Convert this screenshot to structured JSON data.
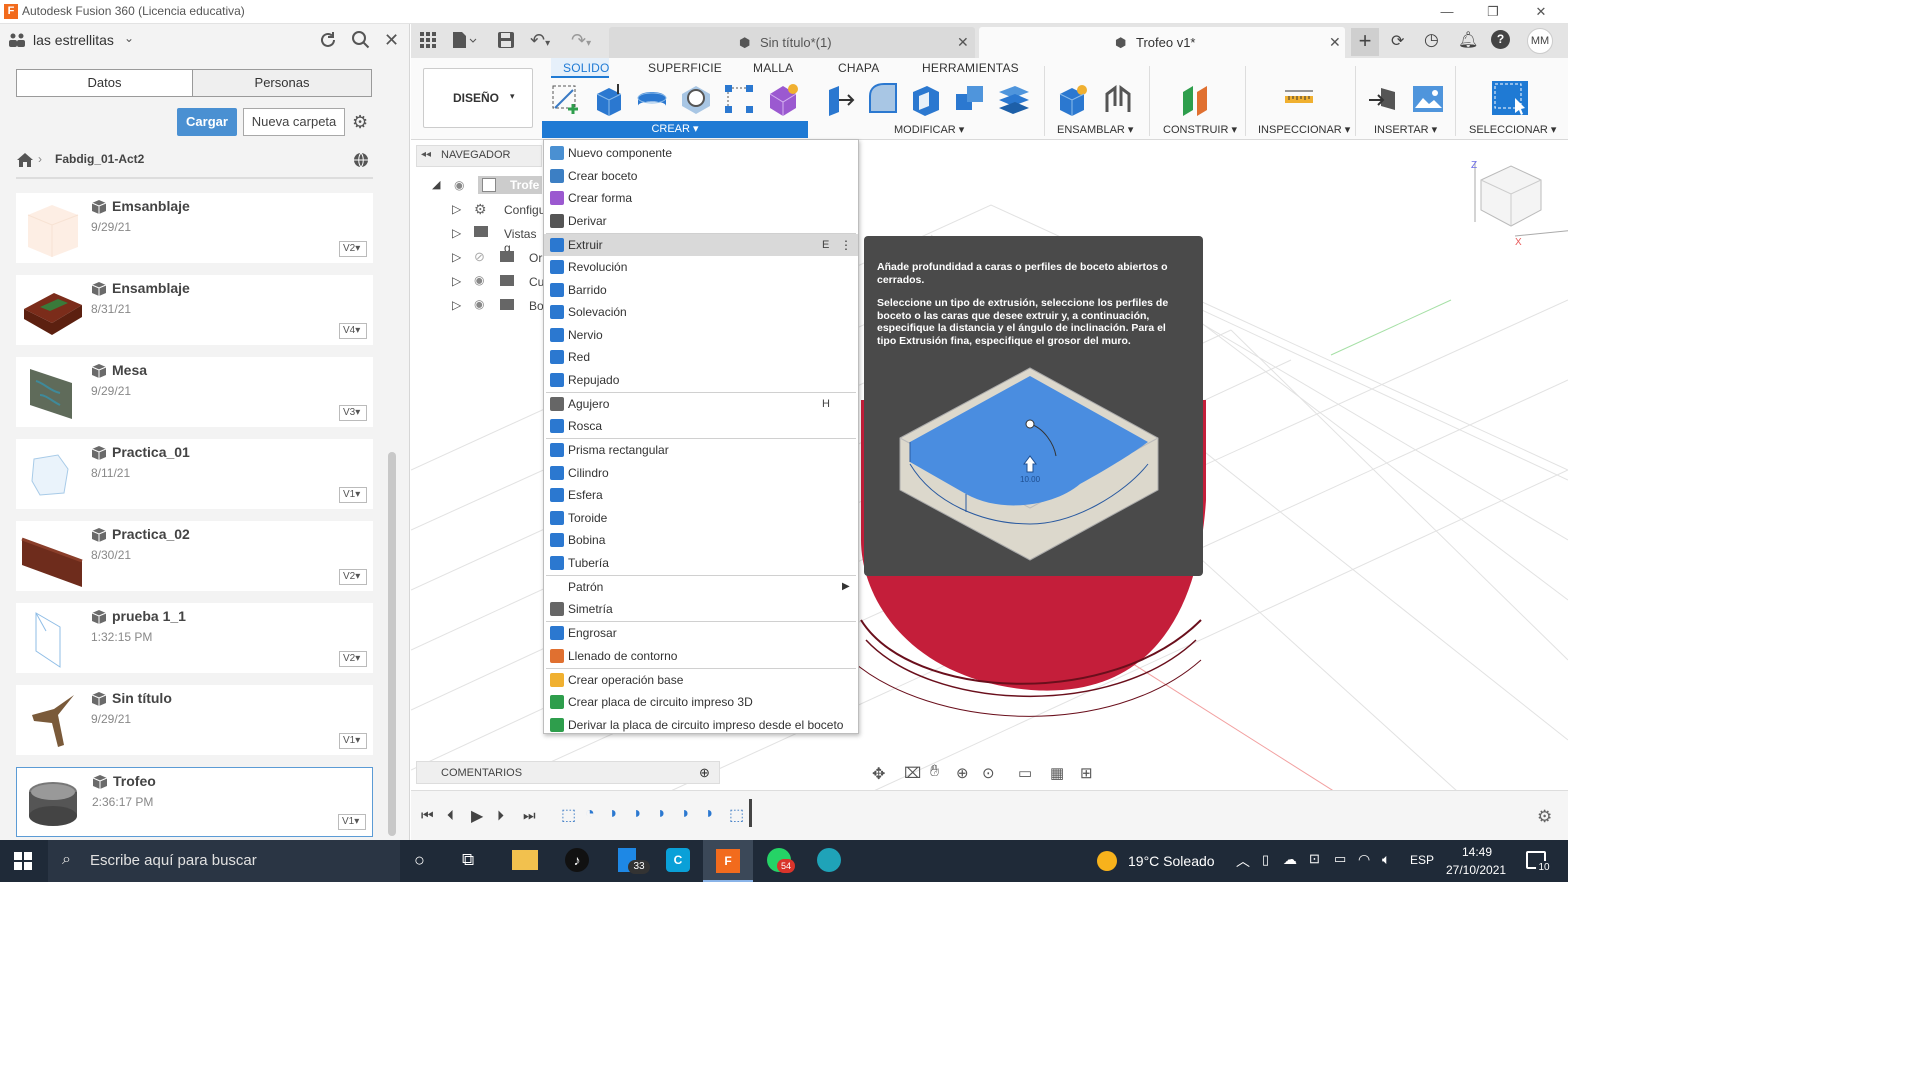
{
  "window": {
    "title": "Autodesk Fusion 360 (Licencia educativa)",
    "logo": "F"
  },
  "data_panel": {
    "team": "las estrellitas",
    "tabs": [
      "Datos",
      "Personas"
    ],
    "upload_label": "Cargar",
    "new_folder_label": "Nueva carpeta",
    "breadcrumb": "Fabdig_01-Act2",
    "files": [
      {
        "name": "Emsanblaje",
        "date": "9/29/21",
        "version": "V2"
      },
      {
        "name": "Ensamblaje",
        "date": "8/31/21",
        "version": "V4"
      },
      {
        "name": "Mesa",
        "date": "9/29/21",
        "version": "V3"
      },
      {
        "name": "Practica_01",
        "date": "8/11/21",
        "version": "V1"
      },
      {
        "name": "Practica_02",
        "date": "8/30/21",
        "version": "V2"
      },
      {
        "name": "prueba 1_1",
        "date": "1:32:15 PM",
        "version": "V2"
      },
      {
        "name": "Sin título",
        "date": "9/29/21",
        "version": "V1"
      },
      {
        "name": "Trofeo",
        "date": "2:36:17 PM",
        "version": "V1"
      }
    ]
  },
  "tabs": [
    {
      "label": "Sin título*(1)"
    },
    {
      "label": "Trofeo v1*"
    }
  ],
  "user_initials": "MM",
  "toolbar": {
    "workspace": "DISEÑO",
    "tabs": [
      "SOLIDO",
      "SUPERFICIE",
      "MALLA",
      "CHAPA",
      "HERRAMIENTAS"
    ],
    "groups": {
      "crear": "CREAR",
      "modificar": "MODIFICAR",
      "ensamblar": "ENSAMBLAR",
      "construir": "CONSTRUIR",
      "inspeccionar": "INSPECCIONAR",
      "insertar": "INSERTAR",
      "seleccionar": "SELECCIONAR"
    }
  },
  "navigator": {
    "title": "NAVEGADOR",
    "items": [
      "Trofe",
      "Configu",
      "Vistas g",
      "Or",
      "Cu",
      "Bo"
    ]
  },
  "comments_label": "COMENTARIOS",
  "menu": [
    {
      "label": "Nuevo componente",
      "icon": "new-component",
      "color": "#4a90d2"
    },
    {
      "label": "Crear boceto",
      "icon": "sketch",
      "color": "#3c7fc4"
    },
    {
      "label": "Crear forma",
      "icon": "form",
      "color": "#9b59d0"
    },
    {
      "label": "Derivar",
      "icon": "derive",
      "color": "#555555"
    },
    {
      "label": "Extruir",
      "icon": "extrude",
      "color": "#2b78d0",
      "shortcut": "E",
      "highlighted": true
    },
    {
      "label": "Revolución",
      "icon": "revolve",
      "color": "#2b78d0"
    },
    {
      "label": "Barrido",
      "icon": "sweep",
      "color": "#2b78d0"
    },
    {
      "label": "Solevación",
      "icon": "loft",
      "color": "#2b78d0"
    },
    {
      "label": "Nervio",
      "icon": "rib",
      "color": "#2b78d0"
    },
    {
      "label": "Red",
      "icon": "web",
      "color": "#2b78d0"
    },
    {
      "label": "Repujado",
      "icon": "emboss",
      "color": "#2b78d0"
    },
    {
      "label": "Agujero",
      "icon": "hole",
      "color": "#666666",
      "shortcut": "H"
    },
    {
      "label": "Rosca",
      "icon": "thread",
      "color": "#2b78d0"
    },
    {
      "label": "Prisma rectangular",
      "icon": "box",
      "color": "#2b78d0"
    },
    {
      "label": "Cilindro",
      "icon": "cylinder",
      "color": "#2b78d0"
    },
    {
      "label": "Esfera",
      "icon": "sphere",
      "color": "#2b78d0"
    },
    {
      "label": "Toroide",
      "icon": "torus",
      "color": "#2b78d0"
    },
    {
      "label": "Bobina",
      "icon": "coil",
      "color": "#2b78d0"
    },
    {
      "label": "Tubería",
      "icon": "pipe",
      "color": "#2b78d0"
    },
    {
      "label": "Patrón",
      "icon": "",
      "color": "",
      "submenu": true
    },
    {
      "label": "Simetría",
      "icon": "mirror",
      "color": "#666666"
    },
    {
      "label": "Engrosar",
      "icon": "thicken",
      "color": "#2b78d0"
    },
    {
      "label": "Llenado de contorno",
      "icon": "boundary-fill",
      "color": "#e07030"
    },
    {
      "label": "Crear operación base",
      "icon": "base-feature",
      "color": "#f0b030"
    },
    {
      "label": "Crear placa de circuito impreso 3D",
      "icon": "pcb",
      "color": "#2e9e4c"
    },
    {
      "label": "Derivar la placa de circuito impreso desde el boceto",
      "icon": "pcb-sketch",
      "color": "#2e9e4c"
    }
  ],
  "tooltip": {
    "line1": "Añade profundidad a caras o perfiles de boceto abiertos o cerrados.",
    "line2": "Seleccione un tipo de extrusión, seleccione los perfiles de boceto o las caras que desee extruir y, a continuación, especifique la distancia y el ángulo de inclinación. Para el tipo Extrusión fina, especifique el grosor del muro.",
    "dim": "10.00"
  },
  "taskbar": {
    "search_placeholder": "Escribe aquí para buscar",
    "weather": "19°C  Soleado",
    "lang": "ESP",
    "time": "14:49",
    "date": "27/10/2021",
    "badge_33": "33",
    "badge_54": "54",
    "notif": "10"
  },
  "colors": {
    "accent": "#1f7ad4",
    "body": "#c8213a",
    "panel": "#f3f3f3"
  }
}
